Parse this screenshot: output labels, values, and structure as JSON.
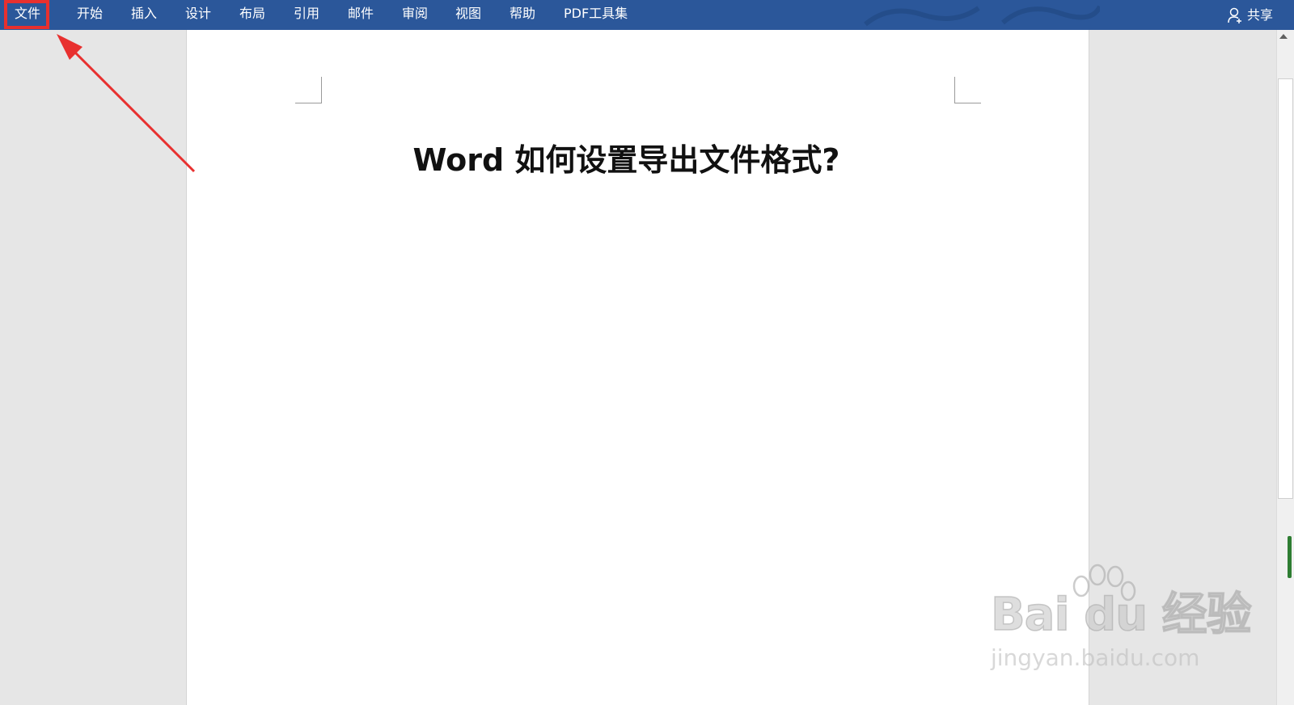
{
  "ribbon": {
    "tabs": [
      {
        "label": "文件",
        "name": "tab-file"
      },
      {
        "label": "开始",
        "name": "tab-home"
      },
      {
        "label": "插入",
        "name": "tab-insert"
      },
      {
        "label": "设计",
        "name": "tab-design"
      },
      {
        "label": "布局",
        "name": "tab-layout"
      },
      {
        "label": "引用",
        "name": "tab-references"
      },
      {
        "label": "邮件",
        "name": "tab-mailings"
      },
      {
        "label": "审阅",
        "name": "tab-review"
      },
      {
        "label": "视图",
        "name": "tab-view"
      },
      {
        "label": "帮助",
        "name": "tab-help"
      },
      {
        "label": "PDF工具集",
        "name": "tab-pdf-tools"
      }
    ],
    "share_label": "共享",
    "bg_color": "#2b579a"
  },
  "document": {
    "title": "Word 如何设置导出文件格式?"
  },
  "annotation": {
    "highlight_color": "#e8302f"
  },
  "watermark": {
    "logo": "Bai du 经验",
    "url": "jingyan.baidu.com"
  }
}
